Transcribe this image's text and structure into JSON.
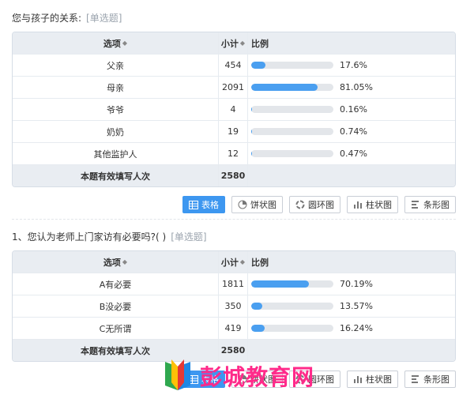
{
  "q0": {
    "title": "您与孩子的关系:",
    "type": "[单选题]",
    "headers": {
      "option": "选项",
      "count": "小计",
      "ratio": "比例"
    },
    "rows": [
      {
        "option": "父亲",
        "count": "454",
        "pct": "17.6%",
        "value": 17.6
      },
      {
        "option": "母亲",
        "count": "2091",
        "pct": "81.05%",
        "value": 81.05
      },
      {
        "option": "爷爷",
        "count": "4",
        "pct": "0.16%",
        "value": 0.16
      },
      {
        "option": "奶奶",
        "count": "19",
        "pct": "0.74%",
        "value": 0.74
      },
      {
        "option": "其他监护人",
        "count": "12",
        "pct": "0.47%",
        "value": 0.47
      }
    ],
    "total_label": "本题有效填写人次",
    "total_count": "2580"
  },
  "q1": {
    "title": "1、您认为老师上门家访有必要吗?( )",
    "type": "[单选题]",
    "headers": {
      "option": "选项",
      "count": "小计",
      "ratio": "比例"
    },
    "rows": [
      {
        "option": "A有必要",
        "count": "1811",
        "pct": "70.19%",
        "value": 70.19
      },
      {
        "option": "B没必要",
        "count": "350",
        "pct": "13.57%",
        "value": 13.57
      },
      {
        "option": "C无所谓",
        "count": "419",
        "pct": "16.24%",
        "value": 16.24
      }
    ],
    "total_label": "本题有效填写人次",
    "total_count": "2580"
  },
  "buttons": {
    "table": "表格",
    "pie": "饼状图",
    "ring": "圆环图",
    "column": "柱状图",
    "bar": "条形图"
  },
  "watermark": "彭城教育网",
  "colors": {
    "accent": "#3d97f0",
    "bar_fill": "#4a9ff0",
    "header_bg": "#e9edf2",
    "watermark": "#ff2a8a"
  }
}
